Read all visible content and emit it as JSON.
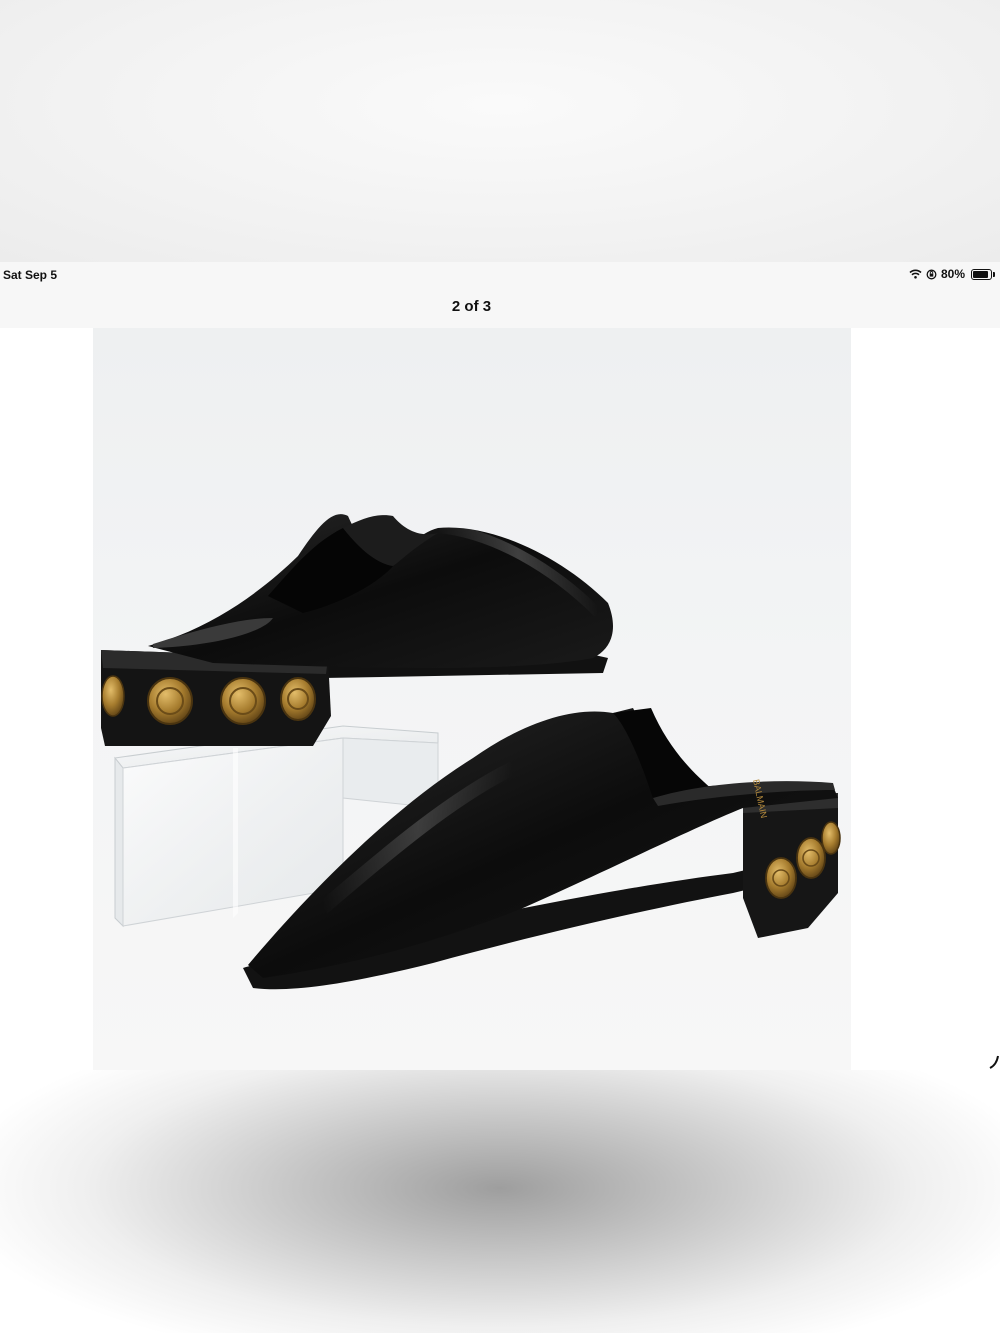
{
  "status_bar": {
    "date": "Sat Sep 5",
    "battery_percent": "80%",
    "battery_level": 0.8,
    "icons": [
      "wifi-icon",
      "orientation-lock-icon",
      "battery-icon"
    ]
  },
  "viewer": {
    "page_indicator": "2 of 3"
  },
  "photo": {
    "subject": "pair of black leather pointed mules with gold coin heels",
    "brand_text": "BALMAIN",
    "colors": {
      "leather": "#0e0e0e",
      "gold": "#a67c2e",
      "background": "#f2f3f4"
    }
  }
}
